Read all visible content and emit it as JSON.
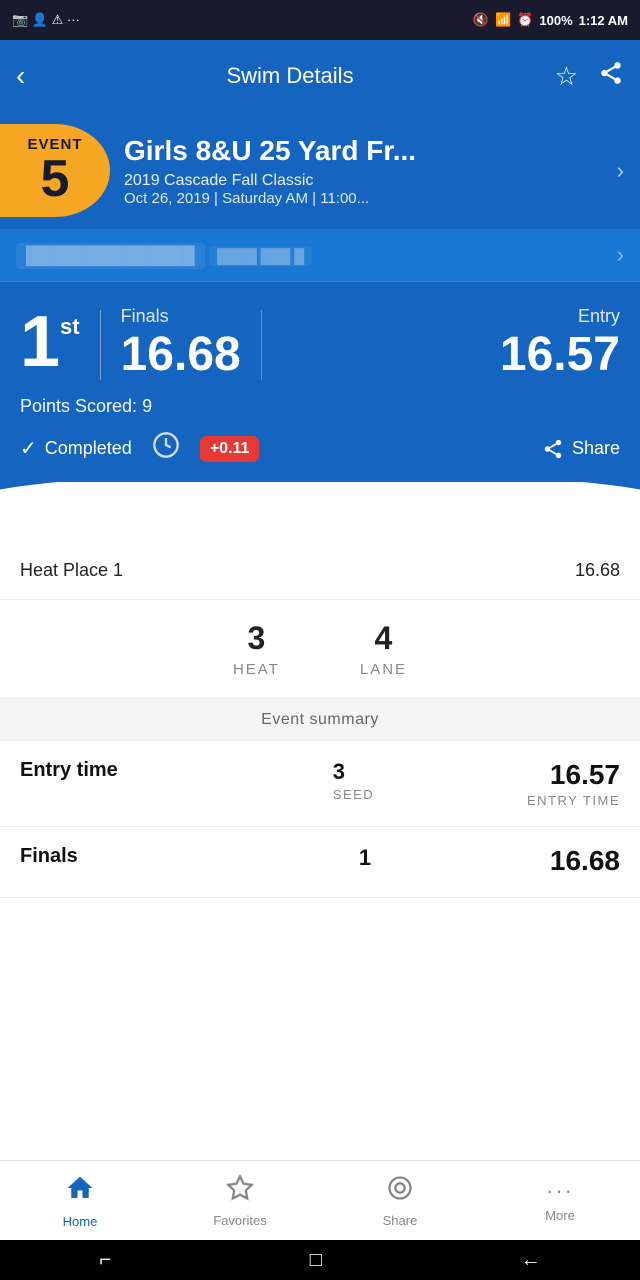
{
  "statusBar": {
    "left": "📷 👤 ⚠ ...",
    "battery": "100%",
    "time": "1:12 AM"
  },
  "header": {
    "title": "Swim Details",
    "backLabel": "‹",
    "favoriteIcon": "☆",
    "shareIcon": "⋮"
  },
  "event": {
    "label": "EVENT",
    "number": "5",
    "name": "Girls 8&U 25 Yard Fr...",
    "meet": "2019 Cascade Fall Classic",
    "dateTime": "Oct 26, 2019 | Saturday AM | 11:00..."
  },
  "swimmer": {
    "name": "Harper Doe Johnson",
    "sub": "Club Pro 4"
  },
  "results": {
    "place": "1",
    "placeSuffix": "st",
    "finalsLabel": "Finals",
    "finalsTime": "16.68",
    "entryLabel": "Entry",
    "entryTime": "16.57",
    "pointsScored": "Points Scored: 9",
    "completedLabel": "Completed",
    "diffBadge": "+0.11",
    "shareLabel": "Share"
  },
  "heatPlace": {
    "label": "Heat Place 1",
    "value": "16.68"
  },
  "heatLane": {
    "heatNum": "3",
    "heatLabel": "HEAT",
    "laneNum": "4",
    "laneLabel": "LANE"
  },
  "eventSummary": {
    "header": "Event summary",
    "rows": [
      {
        "label": "Entry time",
        "midNum": "3",
        "midLabel": "SEED",
        "rightNum": "16.57",
        "rightLabel": "ENTRY TIME"
      },
      {
        "label": "Finals",
        "midNum": "1",
        "midLabel": "",
        "rightNum": "16.68",
        "rightLabel": ""
      }
    ]
  },
  "bottomNav": {
    "items": [
      {
        "label": "Home",
        "icon": "⌂",
        "active": true
      },
      {
        "label": "Favorites",
        "icon": "☆",
        "active": false
      },
      {
        "label": "Share",
        "icon": "◉",
        "active": false
      },
      {
        "label": "More",
        "icon": "···",
        "active": false
      }
    ]
  }
}
